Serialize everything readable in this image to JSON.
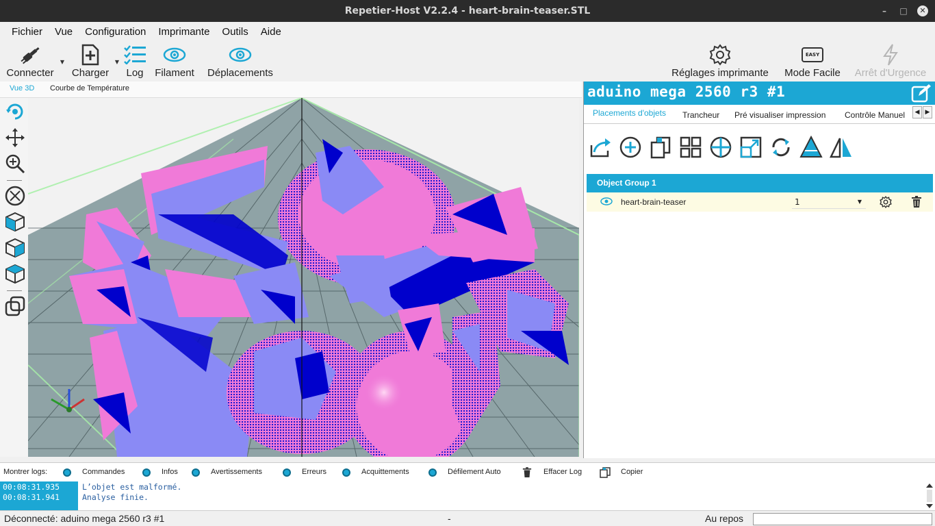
{
  "window": {
    "title": "Repetier-Host V2.2.4 - heart-brain-teaser.STL",
    "controls": [
      "–",
      "□",
      "✕"
    ]
  },
  "menu": [
    "Fichier",
    "Vue",
    "Configuration",
    "Imprimante",
    "Outils",
    "Aide"
  ],
  "toolbar": {
    "connect": "Connecter",
    "load": "Charger",
    "log": "Log",
    "filament": "Filament",
    "moves": "Déplacements",
    "printer_settings": "Réglages imprimante",
    "easy_mode": "Mode Facile",
    "easy_badge": "EASY",
    "emergency": "Arrêt d'Urgence"
  },
  "view_tabs": {
    "view3d": "Vue 3D",
    "temp_curve": "Courbe de Température"
  },
  "printer": {
    "name": "aduino mega 2560 r3 #1"
  },
  "right_tabs": [
    "Placements d'objets",
    "Trancheur",
    "Pré visualiser impression",
    "Contrôle Manuel"
  ],
  "objects": {
    "group": "Object Group 1",
    "items": [
      {
        "name": "heart-brain-teaser",
        "count": "1"
      }
    ]
  },
  "logbar": {
    "show_logs": "Montrer logs:",
    "commands": "Commandes",
    "infos": "Infos",
    "warnings": "Avertissements",
    "errors": "Erreurs",
    "acks": "Acquittements",
    "autoscroll": "Défilement Auto",
    "clear": "Effacer Log",
    "copy": "Copier"
  },
  "log": [
    {
      "time": "00:08:31.935",
      "msg": "L’objet est malformé."
    },
    {
      "time": "00:08:31.941",
      "msg": "Analyse finie."
    }
  ],
  "status": {
    "connection": "Déconnecté: aduino mega 2560 r3 #1",
    "middle": "-",
    "state": "Au repos"
  },
  "colors": {
    "accent": "#1ca7d4",
    "model_pink": "#f07ad8",
    "model_blue": "#8a8af5",
    "model_dark": "#0000cc",
    "bed": "#8fa3a6"
  }
}
